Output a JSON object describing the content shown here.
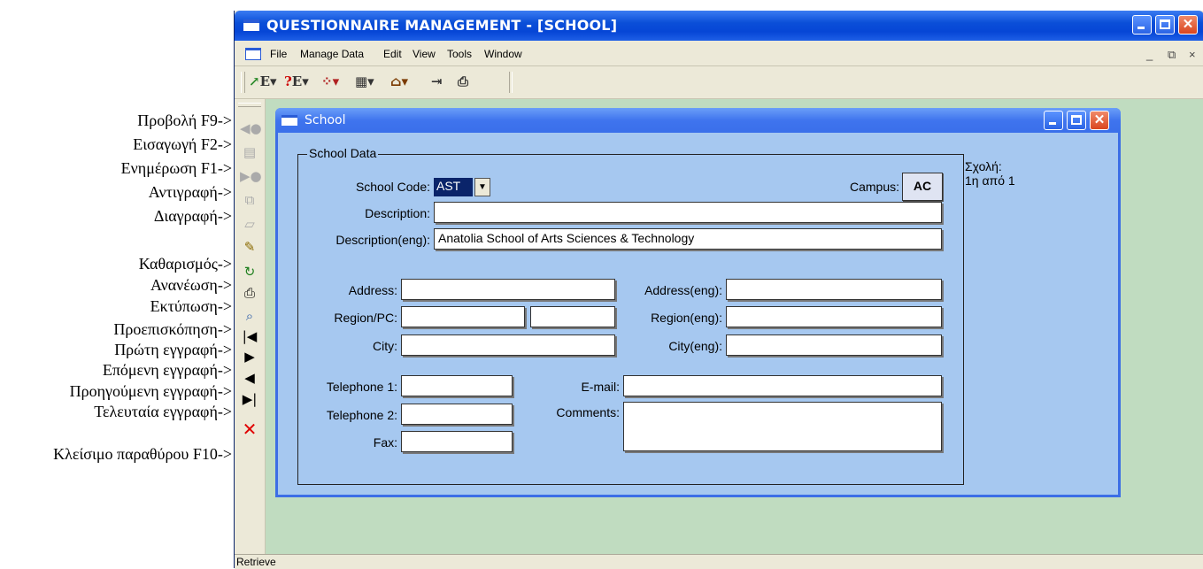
{
  "annotations": [
    {
      "text": "Προβολή F9->"
    },
    {
      "text": "Εισαγωγή F2->"
    },
    {
      "text": "Ενημέρωση F1->"
    },
    {
      "text": "Αντιγραφή->"
    },
    {
      "text": "Διαγραφή->"
    },
    {
      "text": "Καθαρισμός->"
    },
    {
      "text": "Ανανέωση->"
    },
    {
      "text": "Εκτύπωση->"
    },
    {
      "text": "Προεπισκόπηση->"
    },
    {
      "text": "Πρώτη εγγραφή->"
    },
    {
      "text": "Επόμενη εγγραφή->"
    },
    {
      "text": "Προηγούμενη εγγραφή->"
    },
    {
      "text": "Τελευταία εγγραφή->"
    },
    {
      "text": "Κλείσιμο παραθύρου F10->"
    }
  ],
  "window": {
    "title": "QUESTIONNAIRE MANAGEMENT - [SCHOOL]",
    "menu": [
      "File",
      "Manage Data",
      "Edit",
      "View",
      "Tools",
      "Window"
    ],
    "mdi_controls": {
      "min": "_",
      "restore": "⧉",
      "close": "×"
    },
    "status": "Retrieve"
  },
  "child": {
    "title": "School",
    "group_title": "School Data",
    "school_code_label": "School Code:",
    "school_code_value": "AST",
    "campus_label": "Campus:",
    "campus_value": "AC",
    "description_label": "Description:",
    "description_value": "",
    "description_eng_label": "Description(eng):",
    "description_eng_value": "Anatolia School of Arts Sciences & Technology",
    "address_label": "Address:",
    "address_eng_label": "Address(eng):",
    "region_label": "Region/PC:",
    "region_eng_label": "Region(eng):",
    "city_label": "City:",
    "city_eng_label": "City(eng):",
    "telephone1_label": "Telephone 1:",
    "telephone2_label": "Telephone 2:",
    "fax_label": "Fax:",
    "email_label": "E-mail:",
    "comments_label": "Comments:",
    "side_title": "Σχολή:",
    "side_count": "1η από 1"
  }
}
